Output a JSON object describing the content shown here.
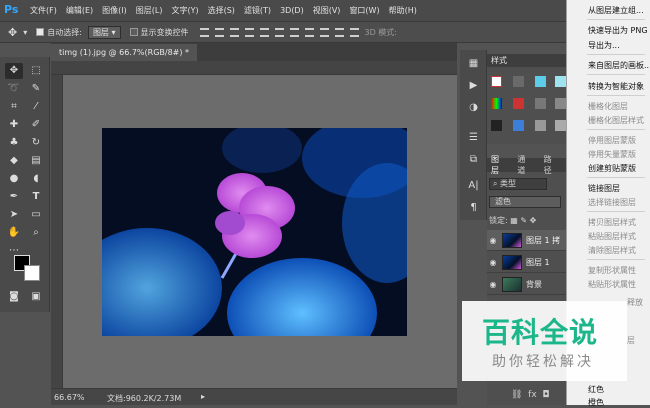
{
  "app": {
    "logo": "Ps"
  },
  "menubar": {
    "items": [
      "文件(F)",
      "编辑(E)",
      "图像(I)",
      "图层(L)",
      "文字(Y)",
      "选择(S)",
      "滤镜(T)",
      "3D(D)",
      "视图(V)",
      "窗口(W)",
      "帮助(H)"
    ]
  },
  "options_bar": {
    "auto_select_label": "自动选择:",
    "auto_select_value": "图层",
    "show_transform_label": "显示变换控件",
    "mode_3d_label": "3D 模式:"
  },
  "document": {
    "tab_title": "timg (1).jpg @ 66.7%(RGB/8#) *",
    "zoom": "66.67%",
    "file_info": "文档:960.2K/2.73M"
  },
  "styles_panel": {
    "title": "样式"
  },
  "layers_panel": {
    "tabs": [
      "图层",
      "通道",
      "路径"
    ],
    "filter_label": "类型",
    "blend_mode": "滤色",
    "lock_label": "锁定:",
    "layers": [
      {
        "name": "图层 1 拷"
      },
      {
        "name": "图层 1"
      },
      {
        "name": "背景"
      }
    ]
  },
  "context_menu": {
    "items": [
      {
        "label": "从图层建立组...",
        "enabled": true
      },
      {
        "label": "快速导出为 PNG",
        "enabled": true
      },
      {
        "label": "导出为...",
        "enabled": true
      },
      {
        "label": "来自图层的画板...",
        "enabled": true
      },
      {
        "label": "转换为智能对象",
        "enabled": true
      },
      {
        "label": "栅格化图层",
        "enabled": false
      },
      {
        "label": "栅格化图层样式",
        "enabled": false
      },
      {
        "label": "停用图层蒙版",
        "enabled": false
      },
      {
        "label": "停用矢量蒙版",
        "enabled": false
      },
      {
        "label": "创建剪贴蒙版",
        "enabled": true
      },
      {
        "label": "链接图层",
        "enabled": true
      },
      {
        "label": "选择链接图层",
        "enabled": false
      },
      {
        "label": "拷贝图层样式",
        "enabled": false
      },
      {
        "label": "粘贴图层样式",
        "enabled": false
      },
      {
        "label": "清除图层样式",
        "enabled": false
      },
      {
        "label": "复制形状属性",
        "enabled": false
      },
      {
        "label": "粘贴形状属性",
        "enabled": false
      },
      {
        "label": "释放",
        "enabled": false
      },
      {
        "label": "层",
        "enabled": false
      },
      {
        "label": "红色",
        "enabled": true
      },
      {
        "label": "橙色",
        "enabled": true
      }
    ]
  },
  "watermark": {
    "title": "百科全说",
    "subtitle": "助你轻松解决"
  },
  "colors": {
    "ps_blue": "#31a8ff",
    "watermark_green": "#1bb68a"
  }
}
